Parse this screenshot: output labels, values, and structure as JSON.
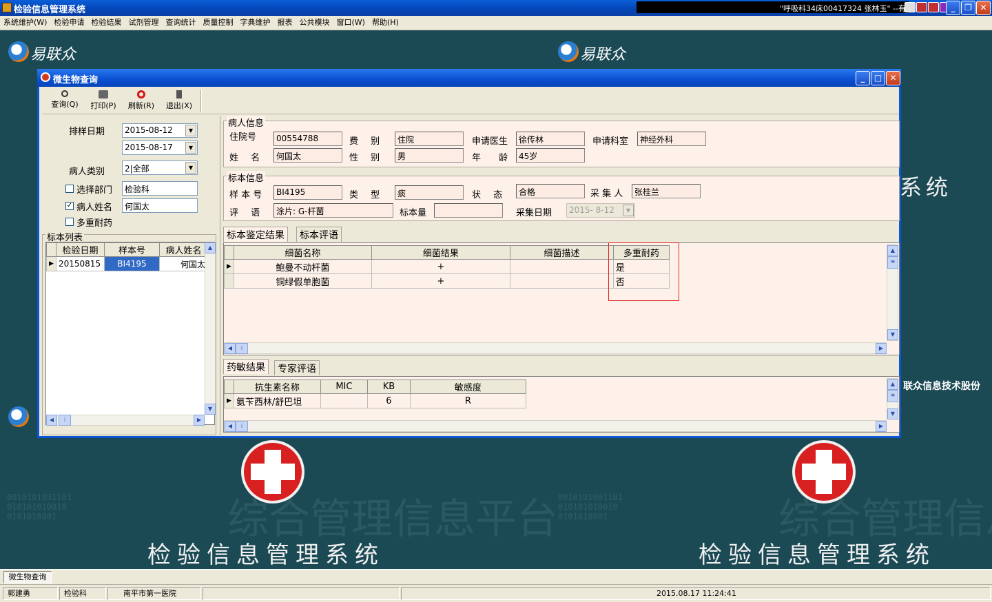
{
  "app": {
    "title": "检验信息管理系统",
    "marquee": "\"呼吸科34床00417324 张林玉\" --有"
  },
  "menu": [
    "系统维护(W)",
    "检验申请",
    "检验结果",
    "试剂管理",
    "查询统计",
    "质量控制",
    "字典维护",
    "报表",
    "公共模块",
    "窗口(W)",
    "帮助(H)"
  ],
  "background": {
    "logo_text": "易联众",
    "big_title": "检验信息管理系统",
    "side_text_1": "系统",
    "side_text_2": "联众信息技术股份",
    "faint_text": "综合管理信息平台"
  },
  "window": {
    "title": "微生物查询",
    "toolbar": {
      "query": "查询(Q)",
      "print": "打印(P)",
      "refresh": "刷新(R)",
      "exit": "退出(X)"
    }
  },
  "filter": {
    "sample_date_label": "排样日期",
    "date_from": "2015-08-12",
    "date_to": "2015-08-17",
    "patient_type_label": "病人类别",
    "patient_type_value": "2|全部",
    "dept_label": "选择部门",
    "dept_checked": false,
    "dept_value": "检验科",
    "name_label": "病人姓名",
    "name_checked": true,
    "name_value": "何国太",
    "mdr_label": "多重耐药",
    "mdr_checked": false
  },
  "sample_list": {
    "title": "标本列表",
    "columns": [
      "检验日期",
      "样本号",
      "病人姓名"
    ],
    "rows": [
      {
        "date": "20150815",
        "sample_no": "BI4195",
        "name": "何国太"
      }
    ]
  },
  "patient": {
    "group_title": "病人信息",
    "inpatient_no_label": "住院号",
    "inpatient_no": "00554788",
    "fee_label": "费 别",
    "fee": "住院",
    "doctor_label": "申请医生",
    "doctor": "徐传林",
    "dept_label": "申请科室",
    "dept": "神经外科",
    "name_label": "姓 名",
    "name": "何国太",
    "sex_label": "性 别",
    "sex": "男",
    "age_label": "年 龄",
    "age": "45岁"
  },
  "specimen": {
    "group_title": "标本信息",
    "sample_no_label": "样 本 号",
    "sample_no": "BI4195",
    "type_label": "类 型",
    "type": "痰",
    "status_label": "状 态",
    "status": "合格",
    "collector_label": "采 集 人",
    "collector": "张桂兰",
    "comment_label": "评 语",
    "comment": "涂片: G-杆菌",
    "amount_label": "标本量",
    "amount": "",
    "collect_date_label": "采集日期",
    "collect_date": "2015- 8-12"
  },
  "tabs_top": [
    "标本鉴定结果",
    "标本评语"
  ],
  "identification": {
    "columns": [
      "细菌名称",
      "细菌结果",
      "细菌描述",
      "多重耐药"
    ],
    "rows": [
      {
        "name": "鲍曼不动杆菌",
        "result": "+",
        "desc": "",
        "mdr": "是"
      },
      {
        "name": "铜绿假单胞菌",
        "result": "+",
        "desc": "",
        "mdr": "否"
      }
    ]
  },
  "tabs_bottom": [
    "药敏结果",
    "专家评语"
  ],
  "susceptibility": {
    "columns": [
      "抗生素名称",
      "MIC",
      "KB",
      "敏感度"
    ],
    "rows": [
      {
        "antibiotic": "氨苄西林/舒巴坦",
        "mic": "",
        "kb": "6",
        "sensitivity": "R"
      }
    ]
  },
  "taskbar": {
    "task": "微生物查询"
  },
  "status": {
    "user": "郭建勇",
    "dept": "检验科",
    "hospital": "南平市第一医院",
    "datetime": "2015.08.17 11:24:41"
  }
}
